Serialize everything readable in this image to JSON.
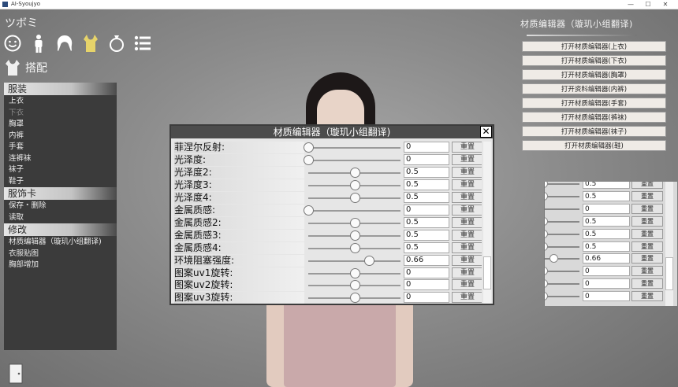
{
  "window": {
    "title": "AI-Syoujyo",
    "min": "—",
    "max": "☐",
    "close": "✕"
  },
  "category": {
    "title": "ツボミ",
    "icons": [
      "face-icon",
      "body-icon",
      "hair-icon",
      "clothing-icon",
      "accessory-icon",
      "list-icon"
    ],
    "selected_icon": "clothing-icon",
    "sub_label": "搭配"
  },
  "left_menu": {
    "sections": [
      {
        "title": "服装",
        "items": [
          {
            "label": "上衣",
            "dim": false
          },
          {
            "label": "下衣",
            "dim": true
          },
          {
            "label": "胸罩",
            "dim": false
          },
          {
            "label": "内裤",
            "dim": false
          },
          {
            "label": "手套",
            "dim": false
          },
          {
            "label": "连裤袜",
            "dim": false
          },
          {
            "label": "袜子",
            "dim": false
          },
          {
            "label": "鞋子",
            "dim": false
          }
        ]
      },
      {
        "title": "服饰卡",
        "items": [
          {
            "label": "保存・删除",
            "dim": false
          },
          {
            "label": "读取",
            "dim": false
          }
        ]
      },
      {
        "title": "修改",
        "items": [
          {
            "label": "材质编辑器（璇玑小组翻译)",
            "dim": false
          },
          {
            "label": "衣服贴图",
            "dim": false
          },
          {
            "label": "胸部增加",
            "dim": false
          }
        ]
      }
    ]
  },
  "right_panel": {
    "title": "材质编辑器（璇玑小组翻译)",
    "buttons": [
      "打开材质编辑器(上衣)",
      "打开材质编辑器(下衣)",
      "打开材质编辑器(胸罩)",
      "打开资料编辑器(内裤)",
      "打开材质编辑器(手套)",
      "打开材质编辑器(裤袜)",
      "打开材质编辑器(袜子)",
      "打开材质编辑器(鞋)"
    ]
  },
  "dialog": {
    "title": "材质编辑器（璇玑小组翻译)",
    "close_label": "✕",
    "reset_label": "重置",
    "rows": [
      {
        "label": "菲涅尔反射:",
        "value": "0",
        "level": 0
      },
      {
        "label": "光泽度:",
        "value": "0",
        "level": 0
      },
      {
        "label": "光泽度2:",
        "value": "0.5",
        "level": 0.5
      },
      {
        "label": "光泽度3:",
        "value": "0.5",
        "level": 0.5
      },
      {
        "label": "光泽度4:",
        "value": "0.5",
        "level": 0.5
      },
      {
        "label": "金属质感:",
        "value": "0",
        "level": 0
      },
      {
        "label": "金属质感2:",
        "value": "0.5",
        "level": 0.5
      },
      {
        "label": "金属质感3:",
        "value": "0.5",
        "level": 0.5
      },
      {
        "label": "金属质感4:",
        "value": "0.5",
        "level": 0.5
      },
      {
        "label": "环境阻塞强度:",
        "value": "0.66",
        "level": 0.66
      },
      {
        "label": "图案uv1旋转:",
        "value": "0",
        "level": 0.5
      },
      {
        "label": "图案uv2旋转:",
        "value": "0",
        "level": 0.5
      },
      {
        "label": "图案uv3旋转:",
        "value": "0",
        "level": 0.5
      }
    ],
    "scroll_position": 0.85
  },
  "background_panel": {
    "reset_label": "重置",
    "rows": [
      {
        "value": "0.5",
        "level": 0.5
      },
      {
        "value": "0.5",
        "level": 0.5
      },
      {
        "value": "0",
        "level": 0
      },
      {
        "value": "0.5",
        "level": 0.5
      },
      {
        "value": "0.5",
        "level": 0.5
      },
      {
        "value": "0.5",
        "level": 0.5
      },
      {
        "value": "0.66",
        "level": 0.66
      },
      {
        "value": "0",
        "level": 0.5
      },
      {
        "value": "0",
        "level": 0.5
      },
      {
        "value": "0",
        "level": 0.5
      }
    ]
  },
  "colors": {
    "accent_icon": "#e6d36a",
    "panel_dark": "#3b3b3b",
    "dialog_header": "#4c4c4c"
  }
}
